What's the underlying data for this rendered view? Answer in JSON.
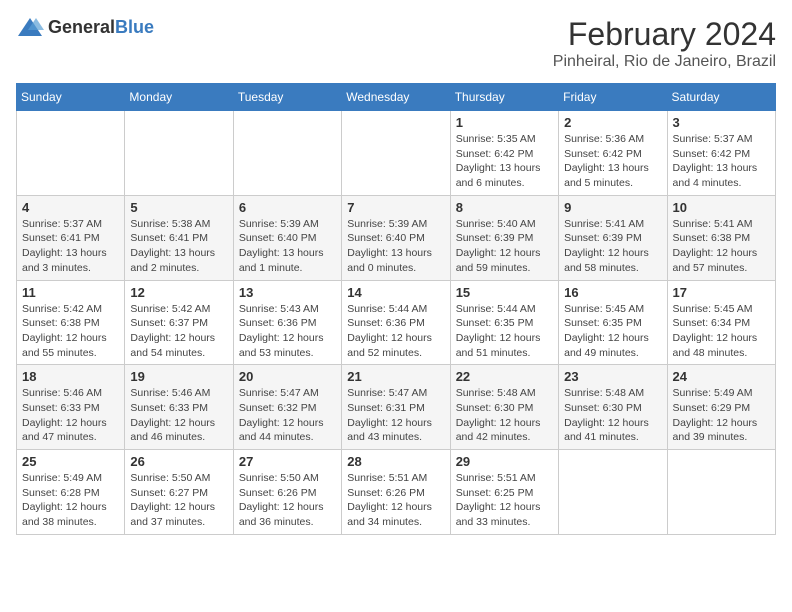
{
  "header": {
    "logo_general": "General",
    "logo_blue": "Blue",
    "month_title": "February 2024",
    "location": "Pinheiral, Rio de Janeiro, Brazil"
  },
  "days_of_week": [
    "Sunday",
    "Monday",
    "Tuesday",
    "Wednesday",
    "Thursday",
    "Friday",
    "Saturday"
  ],
  "weeks": [
    [
      {
        "day": "",
        "info": ""
      },
      {
        "day": "",
        "info": ""
      },
      {
        "day": "",
        "info": ""
      },
      {
        "day": "",
        "info": ""
      },
      {
        "day": "1",
        "info": "Sunrise: 5:35 AM\nSunset: 6:42 PM\nDaylight: 13 hours\nand 6 minutes."
      },
      {
        "day": "2",
        "info": "Sunrise: 5:36 AM\nSunset: 6:42 PM\nDaylight: 13 hours\nand 5 minutes."
      },
      {
        "day": "3",
        "info": "Sunrise: 5:37 AM\nSunset: 6:42 PM\nDaylight: 13 hours\nand 4 minutes."
      }
    ],
    [
      {
        "day": "4",
        "info": "Sunrise: 5:37 AM\nSunset: 6:41 PM\nDaylight: 13 hours\nand 3 minutes."
      },
      {
        "day": "5",
        "info": "Sunrise: 5:38 AM\nSunset: 6:41 PM\nDaylight: 13 hours\nand 2 minutes."
      },
      {
        "day": "6",
        "info": "Sunrise: 5:39 AM\nSunset: 6:40 PM\nDaylight: 13 hours\nand 1 minute."
      },
      {
        "day": "7",
        "info": "Sunrise: 5:39 AM\nSunset: 6:40 PM\nDaylight: 13 hours\nand 0 minutes."
      },
      {
        "day": "8",
        "info": "Sunrise: 5:40 AM\nSunset: 6:39 PM\nDaylight: 12 hours\nand 59 minutes."
      },
      {
        "day": "9",
        "info": "Sunrise: 5:41 AM\nSunset: 6:39 PM\nDaylight: 12 hours\nand 58 minutes."
      },
      {
        "day": "10",
        "info": "Sunrise: 5:41 AM\nSunset: 6:38 PM\nDaylight: 12 hours\nand 57 minutes."
      }
    ],
    [
      {
        "day": "11",
        "info": "Sunrise: 5:42 AM\nSunset: 6:38 PM\nDaylight: 12 hours\nand 55 minutes."
      },
      {
        "day": "12",
        "info": "Sunrise: 5:42 AM\nSunset: 6:37 PM\nDaylight: 12 hours\nand 54 minutes."
      },
      {
        "day": "13",
        "info": "Sunrise: 5:43 AM\nSunset: 6:36 PM\nDaylight: 12 hours\nand 53 minutes."
      },
      {
        "day": "14",
        "info": "Sunrise: 5:44 AM\nSunset: 6:36 PM\nDaylight: 12 hours\nand 52 minutes."
      },
      {
        "day": "15",
        "info": "Sunrise: 5:44 AM\nSunset: 6:35 PM\nDaylight: 12 hours\nand 51 minutes."
      },
      {
        "day": "16",
        "info": "Sunrise: 5:45 AM\nSunset: 6:35 PM\nDaylight: 12 hours\nand 49 minutes."
      },
      {
        "day": "17",
        "info": "Sunrise: 5:45 AM\nSunset: 6:34 PM\nDaylight: 12 hours\nand 48 minutes."
      }
    ],
    [
      {
        "day": "18",
        "info": "Sunrise: 5:46 AM\nSunset: 6:33 PM\nDaylight: 12 hours\nand 47 minutes."
      },
      {
        "day": "19",
        "info": "Sunrise: 5:46 AM\nSunset: 6:33 PM\nDaylight: 12 hours\nand 46 minutes."
      },
      {
        "day": "20",
        "info": "Sunrise: 5:47 AM\nSunset: 6:32 PM\nDaylight: 12 hours\nand 44 minutes."
      },
      {
        "day": "21",
        "info": "Sunrise: 5:47 AM\nSunset: 6:31 PM\nDaylight: 12 hours\nand 43 minutes."
      },
      {
        "day": "22",
        "info": "Sunrise: 5:48 AM\nSunset: 6:30 PM\nDaylight: 12 hours\nand 42 minutes."
      },
      {
        "day": "23",
        "info": "Sunrise: 5:48 AM\nSunset: 6:30 PM\nDaylight: 12 hours\nand 41 minutes."
      },
      {
        "day": "24",
        "info": "Sunrise: 5:49 AM\nSunset: 6:29 PM\nDaylight: 12 hours\nand 39 minutes."
      }
    ],
    [
      {
        "day": "25",
        "info": "Sunrise: 5:49 AM\nSunset: 6:28 PM\nDaylight: 12 hours\nand 38 minutes."
      },
      {
        "day": "26",
        "info": "Sunrise: 5:50 AM\nSunset: 6:27 PM\nDaylight: 12 hours\nand 37 minutes."
      },
      {
        "day": "27",
        "info": "Sunrise: 5:50 AM\nSunset: 6:26 PM\nDaylight: 12 hours\nand 36 minutes."
      },
      {
        "day": "28",
        "info": "Sunrise: 5:51 AM\nSunset: 6:26 PM\nDaylight: 12 hours\nand 34 minutes."
      },
      {
        "day": "29",
        "info": "Sunrise: 5:51 AM\nSunset: 6:25 PM\nDaylight: 12 hours\nand 33 minutes."
      },
      {
        "day": "",
        "info": ""
      },
      {
        "day": "",
        "info": ""
      }
    ]
  ]
}
